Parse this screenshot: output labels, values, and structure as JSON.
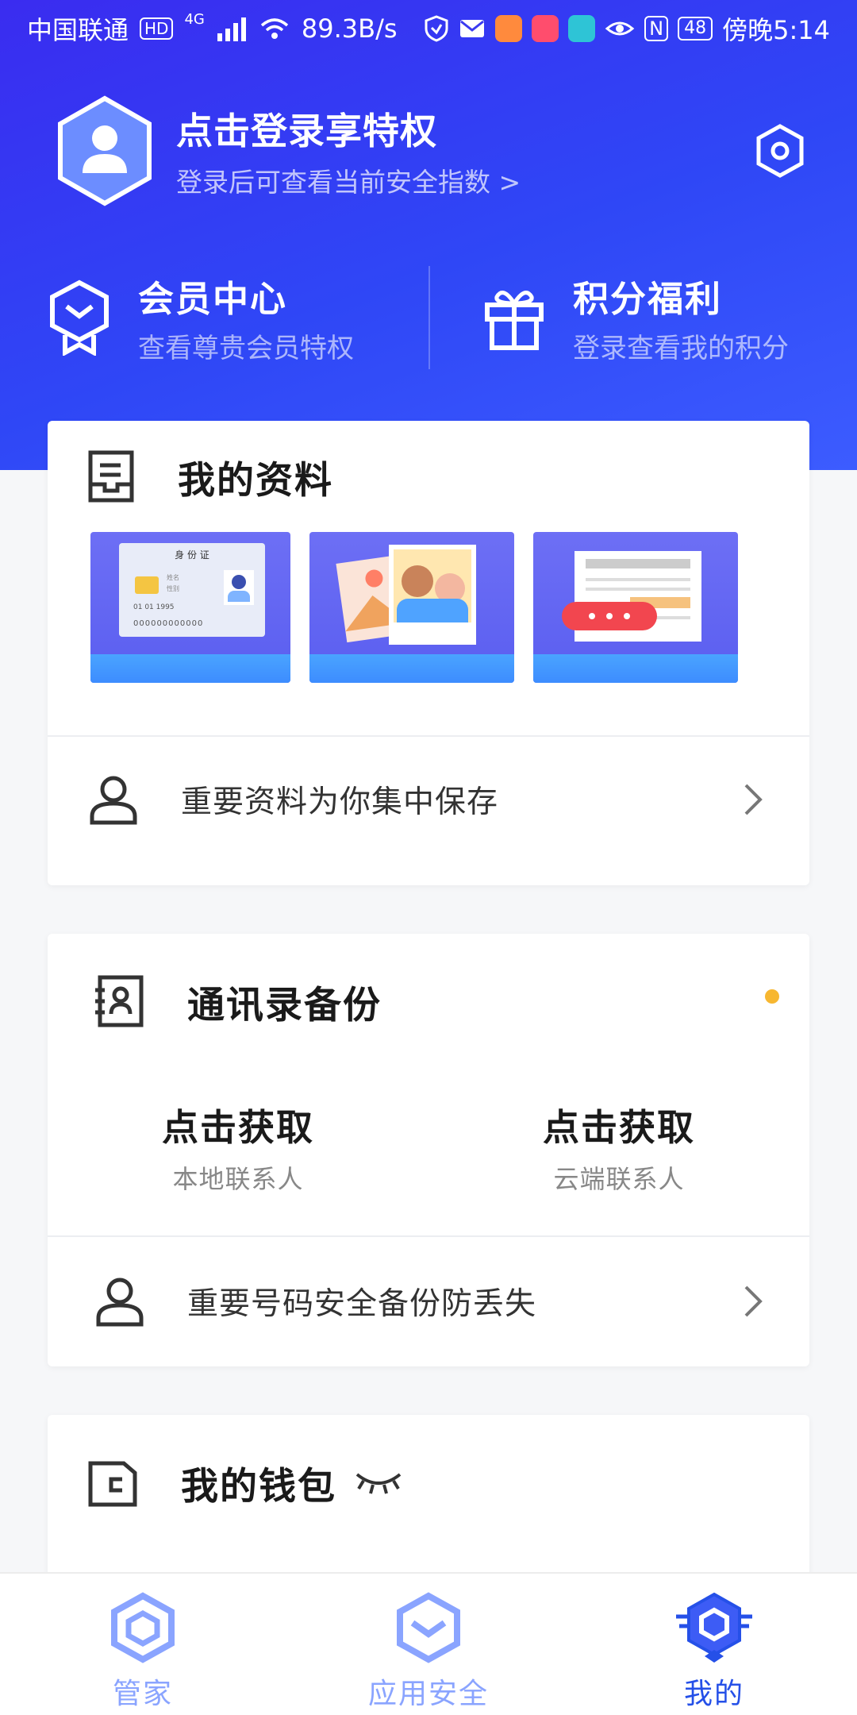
{
  "status_bar": {
    "carrier": "中国联通",
    "hd_badge": "HD",
    "net_type": "4G",
    "speed": "89.3B/s",
    "nfc": "N",
    "battery": "48",
    "time": "傍晚5:14"
  },
  "profile": {
    "title": "点击登录享特权",
    "subtitle": "登录后可查看当前安全指数 >"
  },
  "perks": [
    {
      "title": "会员中心",
      "subtitle": "查看尊贵会员特权",
      "icon": "member-badge-icon"
    },
    {
      "title": "积分福利",
      "subtitle": "登录查看我的积分",
      "icon": "gift-icon"
    }
  ],
  "my_data": {
    "title": "我的资料",
    "id_card_title": "身 份 证",
    "id_card_name": "姓名",
    "id_card_gender": "性别",
    "id_card_date": "01  01  1995",
    "id_card_number": "000000000000",
    "row_label": "重要资料为你集中保存"
  },
  "contacts": {
    "title": "通讯录备份",
    "stats": [
      {
        "value": "点击获取",
        "label": "本地联系人"
      },
      {
        "value": "点击获取",
        "label": "云端联系人"
      }
    ],
    "row_label": "重要号码安全备份防丢失"
  },
  "wallet": {
    "title": "我的钱包"
  },
  "tabs": [
    {
      "label": "管家",
      "active": false
    },
    {
      "label": "应用安全",
      "active": false
    },
    {
      "label": "我的",
      "active": true
    }
  ],
  "colors": {
    "accent": "#2550e8",
    "hero_start": "#3a2cf0",
    "hero_end": "#3c5cff",
    "dot": "#f7b731"
  }
}
